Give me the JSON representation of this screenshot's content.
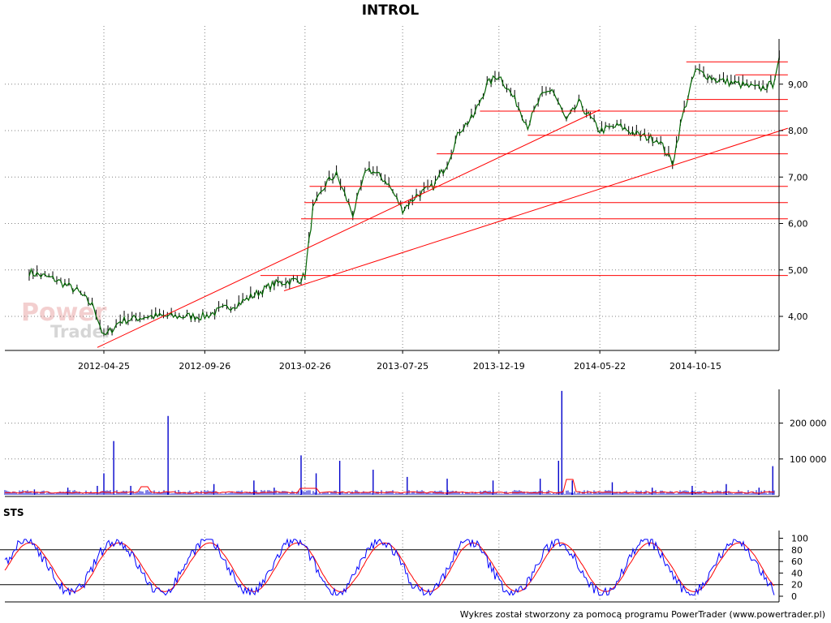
{
  "title": "INTROL",
  "footer": "Wykres został stworzony za pomocą programu PowerTrader (www.powertrader.pl)",
  "watermark": {
    "line1": "Power",
    "line2": "Trader"
  },
  "colors": {
    "price": "#006400",
    "trend": "#ff0000",
    "volume": "#0000cc",
    "volume_avg": "#ff0000",
    "sts_k": "#0000ff",
    "sts_d": "#ff0000",
    "grid": "#808080"
  },
  "chart_data": [
    {
      "type": "line",
      "name": "price",
      "x_ticks": [
        "2012-04-25",
        "2012-09-26",
        "2013-02-26",
        "2013-07-25",
        "2013-12-19",
        "2014-05-22",
        "2014-10-15"
      ],
      "y_ticks": [
        "4,00",
        "5,00",
        "6,00",
        "7,00",
        "8,00",
        "9,00"
      ],
      "ylim": [
        3.3,
        10.0
      ],
      "grid": true,
      "x": [
        "2012-01-02",
        "2012-02-10",
        "2012-03-15",
        "2012-04-10",
        "2012-04-25",
        "2012-05-20",
        "2012-07-01",
        "2012-09-26",
        "2012-11-20",
        "2013-01-10",
        "2013-02-20",
        "2013-02-26",
        "2013-03-10",
        "2013-04-01",
        "2013-04-15",
        "2013-05-10",
        "2013-06-01",
        "2013-07-01",
        "2013-07-25",
        "2013-08-15",
        "2013-09-10",
        "2013-10-01",
        "2013-10-20",
        "2013-11-10",
        "2013-12-01",
        "2013-12-19",
        "2014-01-15",
        "2014-02-01",
        "2014-02-20",
        "2014-03-10",
        "2014-04-01",
        "2014-04-20",
        "2014-05-22",
        "2014-06-20",
        "2014-07-20",
        "2014-08-20",
        "2014-09-10",
        "2014-09-25",
        "2014-10-15",
        "2014-11-15",
        "2014-12-20",
        "2015-01-20",
        "2015-02-10",
        "2015-02-20"
      ],
      "values": [
        4.95,
        4.8,
        4.55,
        4.2,
        3.55,
        3.9,
        4.0,
        4.0,
        4.3,
        4.7,
        4.8,
        4.9,
        6.3,
        6.9,
        7.05,
        6.2,
        7.2,
        6.9,
        6.3,
        6.6,
        6.8,
        7.3,
        8.0,
        8.3,
        9.0,
        9.2,
        8.6,
        8.1,
        8.7,
        8.9,
        8.2,
        8.6,
        8.0,
        8.1,
        7.9,
        7.8,
        7.3,
        8.3,
        9.3,
        9.1,
        9.0,
        8.9,
        9.0,
        9.6
      ]
    },
    {
      "type": "bar",
      "name": "volume",
      "y_ticks": [
        "100 000",
        "200 000"
      ],
      "ylim": [
        0,
        290000
      ],
      "x": [
        "2012-01-10",
        "2012-03-01",
        "2012-04-15",
        "2012-04-25",
        "2012-05-10",
        "2012-06-05",
        "2012-08-01",
        "2012-10-10",
        "2012-12-10",
        "2013-01-10",
        "2013-02-20",
        "2013-03-15",
        "2013-04-20",
        "2013-06-10",
        "2013-08-01",
        "2013-10-01",
        "2013-12-10",
        "2014-02-20",
        "2014-03-20",
        "2014-03-25",
        "2014-04-10",
        "2014-06-10",
        "2014-08-10",
        "2014-10-10",
        "2014-12-01",
        "2015-01-20",
        "2015-02-10"
      ],
      "values": [
        15000,
        20000,
        25000,
        60000,
        150000,
        25000,
        220000,
        30000,
        40000,
        20000,
        110000,
        60000,
        95000,
        70000,
        50000,
        45000,
        40000,
        45000,
        95000,
        290000,
        40000,
        35000,
        20000,
        25000,
        30000,
        20000,
        80000
      ]
    },
    {
      "type": "line",
      "name": "STS",
      "y_ticks": [
        "0",
        "20",
        "40",
        "60",
        "80",
        "100"
      ],
      "ylim": [
        0,
        100
      ],
      "levels": [
        20,
        80
      ]
    }
  ]
}
